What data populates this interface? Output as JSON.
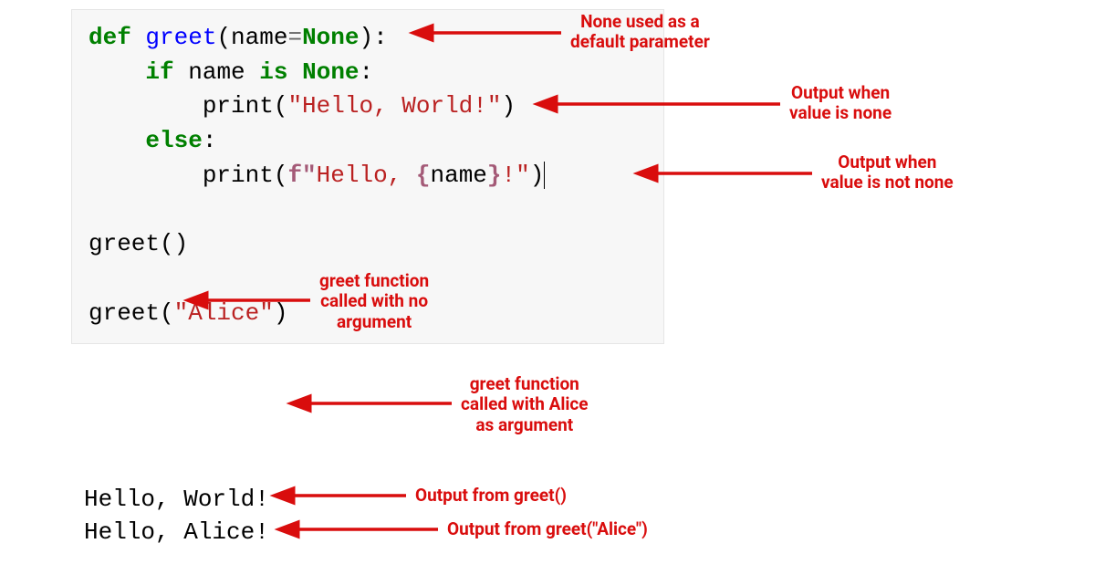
{
  "code": {
    "line1": {
      "def": "def",
      "fn": "greet",
      "p_open": "(",
      "param": "name",
      "eq": "=",
      "none": "None",
      "p_close": ")",
      "colon": ":"
    },
    "line2": {
      "if": "if",
      "var": "name",
      "is": "is",
      "none": "None",
      "colon": ":"
    },
    "line3": {
      "print": "print",
      "p_open": "(",
      "str": "\"Hello, World!\"",
      "p_close": ")"
    },
    "line4": {
      "else": "else",
      "colon": ":"
    },
    "line5": {
      "print": "print",
      "p_open": "(",
      "f": "f\"",
      "pre": "Hello, ",
      "br_open": "{",
      "var": "name",
      "br_close": "}",
      "suf": "!\"",
      "p_close": ")"
    },
    "line6_blank": "",
    "line7": {
      "fn": "greet",
      "body": "()"
    },
    "line8_blank": "",
    "line9": {
      "fn": "greet",
      "p_open": "(",
      "arg": "\"Alice\"",
      "p_close": ")"
    }
  },
  "output": {
    "line1": "Hello, World!",
    "line2": "Hello, Alice!"
  },
  "annotations": {
    "a1": "None used as a\ndefault parameter",
    "a2": "Output when\nvalue is none",
    "a3": "Output when\nvalue is not none",
    "a4": "greet function\ncalled with no\nargument",
    "a5": "greet function\ncalled with Alice\nas argument",
    "a6": "Output from greet()",
    "a7": "Output from greet(\"Alice\")"
  },
  "colors": {
    "annotation": "#d90d0d",
    "keyword": "#008000",
    "function": "#0000ff",
    "string": "#ba2121",
    "code_bg": "#f7f7f7"
  }
}
